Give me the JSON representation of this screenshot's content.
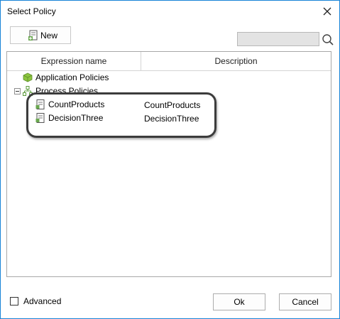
{
  "window": {
    "title": "Select Policy"
  },
  "toolbar": {
    "new_label": "New"
  },
  "search": {
    "value": ""
  },
  "grid": {
    "columns": [
      "Expression name",
      "Description"
    ],
    "tree": {
      "application": {
        "label": "Application Policies"
      },
      "process": {
        "label": "Process Policies",
        "children": [
          {
            "name": "CountProducts",
            "description": "CountProducts"
          },
          {
            "name": "DecisionThree",
            "description": "DecisionThree"
          }
        ]
      }
    }
  },
  "footer": {
    "advanced_label": "Advanced",
    "ok_label": "Ok",
    "cancel_label": "Cancel"
  },
  "colors": {
    "window_border": "#1883d7",
    "app_policy_icon": "#8dc63f",
    "process_icon": "#5a9a3a"
  },
  "icons": [
    "close-icon",
    "new-document-icon",
    "search-icon",
    "cube-icon",
    "hierarchy-icon",
    "policy-document-icon"
  ]
}
